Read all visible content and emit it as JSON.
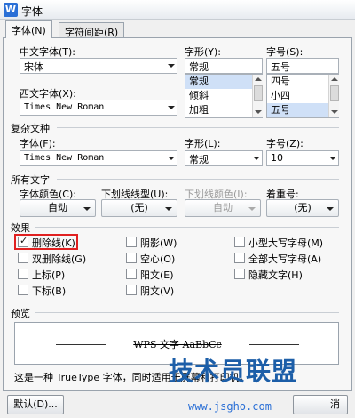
{
  "window": {
    "title": "字体",
    "app_icon": "W"
  },
  "tabs": [
    {
      "label": "字体(N)"
    },
    {
      "label": "字符间距(R)"
    }
  ],
  "chinese_font": {
    "label": "中文字体(T):",
    "value": "宋体"
  },
  "style": {
    "label": "字形(Y):",
    "value": "常规",
    "options": [
      "常规",
      "倾斜",
      "加粗"
    ],
    "selected_index": 0
  },
  "size": {
    "label": "字号(S):",
    "value": "五号",
    "options": [
      "四号",
      "小四",
      "五号"
    ],
    "selected_index": 2
  },
  "western_font": {
    "label": "西文字体(X):",
    "value": "Times New Roman"
  },
  "complex": {
    "section": "复杂文种",
    "font_label": "字体(F):",
    "font_value": "Times New Roman",
    "style_label": "字形(L):",
    "style_value": "常规",
    "size_label": "字号(Z):",
    "size_value": "10"
  },
  "all_text": {
    "section": "所有文字",
    "color_label": "字体颜色(C):",
    "color_value": "自动",
    "underline_label": "下划线线型(U):",
    "underline_value": "(无)",
    "underline_color_label": "下划线颜色(I):",
    "underline_color_value": "自动",
    "emphasis_label": "着重号:",
    "emphasis_value": "(无)"
  },
  "effects": {
    "section": "效果",
    "items": [
      {
        "label": "删除线(K)",
        "checked": true
      },
      {
        "label": "双删除线(G)",
        "checked": false
      },
      {
        "label": "上标(P)",
        "checked": false
      },
      {
        "label": "下标(B)",
        "checked": false
      },
      {
        "label": "阴影(W)",
        "checked": false
      },
      {
        "label": "空心(O)",
        "checked": false
      },
      {
        "label": "阳文(E)",
        "checked": false
      },
      {
        "label": "阴文(V)",
        "checked": false
      },
      {
        "label": "小型大写字母(M)",
        "checked": false
      },
      {
        "label": "全部大写字母(A)",
        "checked": false
      },
      {
        "label": "隐藏文字(H)",
        "checked": false
      }
    ],
    "highlight_color": "#e02020"
  },
  "preview": {
    "section": "预览",
    "sample": "WPS 文字 AaBbCc",
    "note": "这是一种 TrueType 字体，同时适用于屏幕和打印机。"
  },
  "buttons": {
    "default": "默认(D)...",
    "cancel": "消"
  },
  "watermark": {
    "text": "技术员联盟",
    "url": "www.jsgho.com"
  }
}
